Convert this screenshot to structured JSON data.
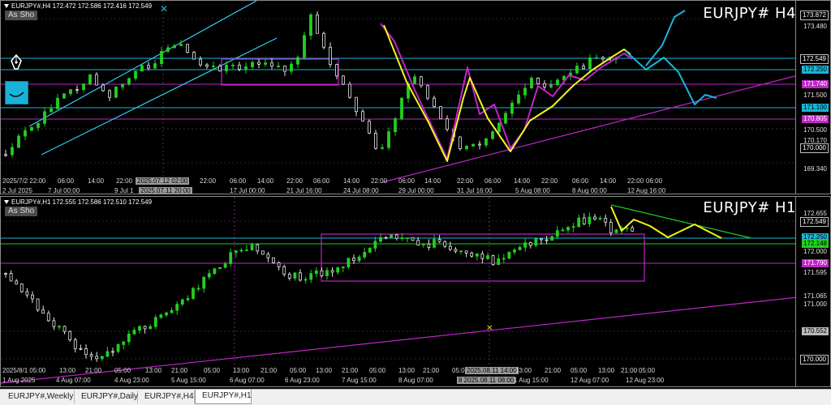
{
  "colors": {
    "cyan": "#17b6d8",
    "magenta": "#c026c8",
    "yellow": "#f5f51e",
    "green_line": "#21d021",
    "bull": "#21d021",
    "bear": "#e8e8e8",
    "channel": "#2fd0f0",
    "grid": "#444444"
  },
  "pane1": {
    "header": "EURJPY#,H4  172.472 172.586 172.416 172.549",
    "as_show": "As Sho",
    "title": "EURJPY#  H4",
    "price_labels": [
      "173.872",
      "173.480",
      "172.549",
      "172.250",
      "171.740",
      "171.500",
      "171.100",
      "170.805",
      "170.500",
      "170.170",
      "170.000",
      "169.340"
    ],
    "time_labels": [
      "2025/7/2 22:00",
      "06:00",
      "14:00",
      "22:00",
      "2025.07.12 02:00",
      "22:00",
      "06:00",
      "14:00",
      "22:00",
      "06:00",
      "14:00",
      "22:00",
      "06:00",
      "14:00",
      "22:00",
      "06:00",
      "14:00",
      "22:00",
      "06:00",
      "14:00",
      "22:00",
      "06:00",
      "14:00",
      "22:00"
    ],
    "date_labels": [
      "2 Jul 2025",
      "7 Jul 00:00",
      "9 Jul 1",
      "2025.07.11 20:00",
      "17 Jul 00:00",
      "21 Jul 16:00",
      "24 Jul 08:00",
      "29 Jul 00:00",
      "31 Jul 16:00",
      "5 Aug 08:00",
      "8 Aug 00:00",
      "12 Aug 16:00"
    ]
  },
  "pane2": {
    "header": "EURJPY#,H1  172.555 172.586 172.510 172.549",
    "as_show": "As Sho",
    "title": "EURJPY#  H1",
    "price_labels": [
      "172.655",
      "172.549",
      "172.250",
      "172.148",
      "172.000",
      "171.790",
      "171.595",
      "171.065",
      "171.000",
      "170.552",
      "170.000"
    ],
    "time_labels": [
      "2025/8/1 05:00",
      "13:00",
      "21:00",
      "05:00",
      "13:00",
      "21:00",
      "05:00",
      "13:00",
      "21:00",
      "05:00",
      "13:00",
      "21:00",
      "05:00",
      "13:00",
      "21:00",
      "05:00",
      "13:00",
      "21:00",
      "2025.08.11 14:00",
      "13:00",
      "21:00",
      "05:00",
      "13:00",
      "21:00",
      "05:00"
    ],
    "date_labels": [
      "1 Aug 2025",
      "4 Aug 07:00",
      "4 Aug 23:00",
      "5 Aug 15:00",
      "6 Aug 07:00",
      "6 Aug 23:00",
      "7 Aug 15:00",
      "8 Aug 07:00",
      "8 2025.08.11 08:00",
      "1 Aug 15:00",
      "12 Aug 07:00",
      "12 Aug 23:00"
    ]
  },
  "tabs": [
    "EURJPY#,Weekly",
    "EURJPY#,Daily",
    "EURJPY#,H4",
    "EURJPY#,H1"
  ],
  "active_tab": "EURJPY#,H1",
  "icons": {
    "pen": "pen-nib-icon",
    "thumbnail": "chart-thumbnail-icon",
    "crosshair": "crosshair-icon"
  }
}
